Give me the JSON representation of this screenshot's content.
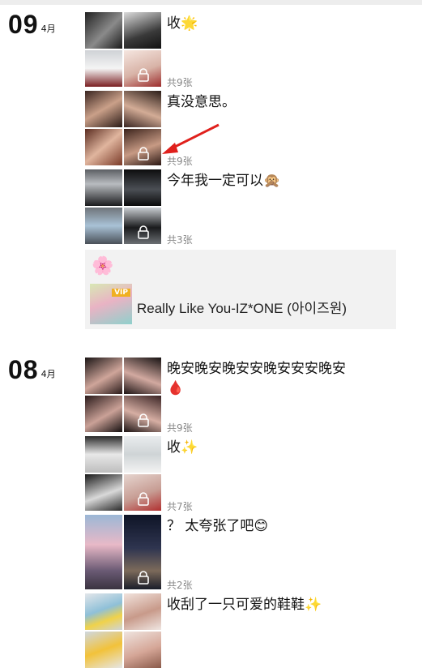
{
  "days": [
    {
      "day": "09",
      "month": "4月"
    },
    {
      "day": "08",
      "month": "4月"
    }
  ],
  "posts": [
    {
      "caption": "收",
      "emoji": "🌟",
      "count": "共9张"
    },
    {
      "caption": "真没意思。",
      "emoji": "",
      "count": "共9张"
    },
    {
      "caption": "今年我一定可以",
      "emoji": "🙊",
      "count": "共3张"
    },
    {
      "caption": "晚安晚安晚安安晚安安安晚安",
      "emoji": "🩸",
      "count": "共9张"
    },
    {
      "caption": "收",
      "emoji": "✨",
      "count": "共7张"
    },
    {
      "caption": "？ 太夸张了吧",
      "emoji": "😊",
      "count": "共2张"
    },
    {
      "caption": "收刮了一只可爱的鞋鞋",
      "emoji": "✨",
      "count": ""
    }
  ],
  "music": {
    "flower": "🌸",
    "song": "Really Like You-IZ*ONE (아이즈원)",
    "cover_badge": "VIP"
  },
  "colors": {
    "lock": "#ffffff",
    "arrow": "#e0201c",
    "music_bg": "#f2f2f2"
  }
}
